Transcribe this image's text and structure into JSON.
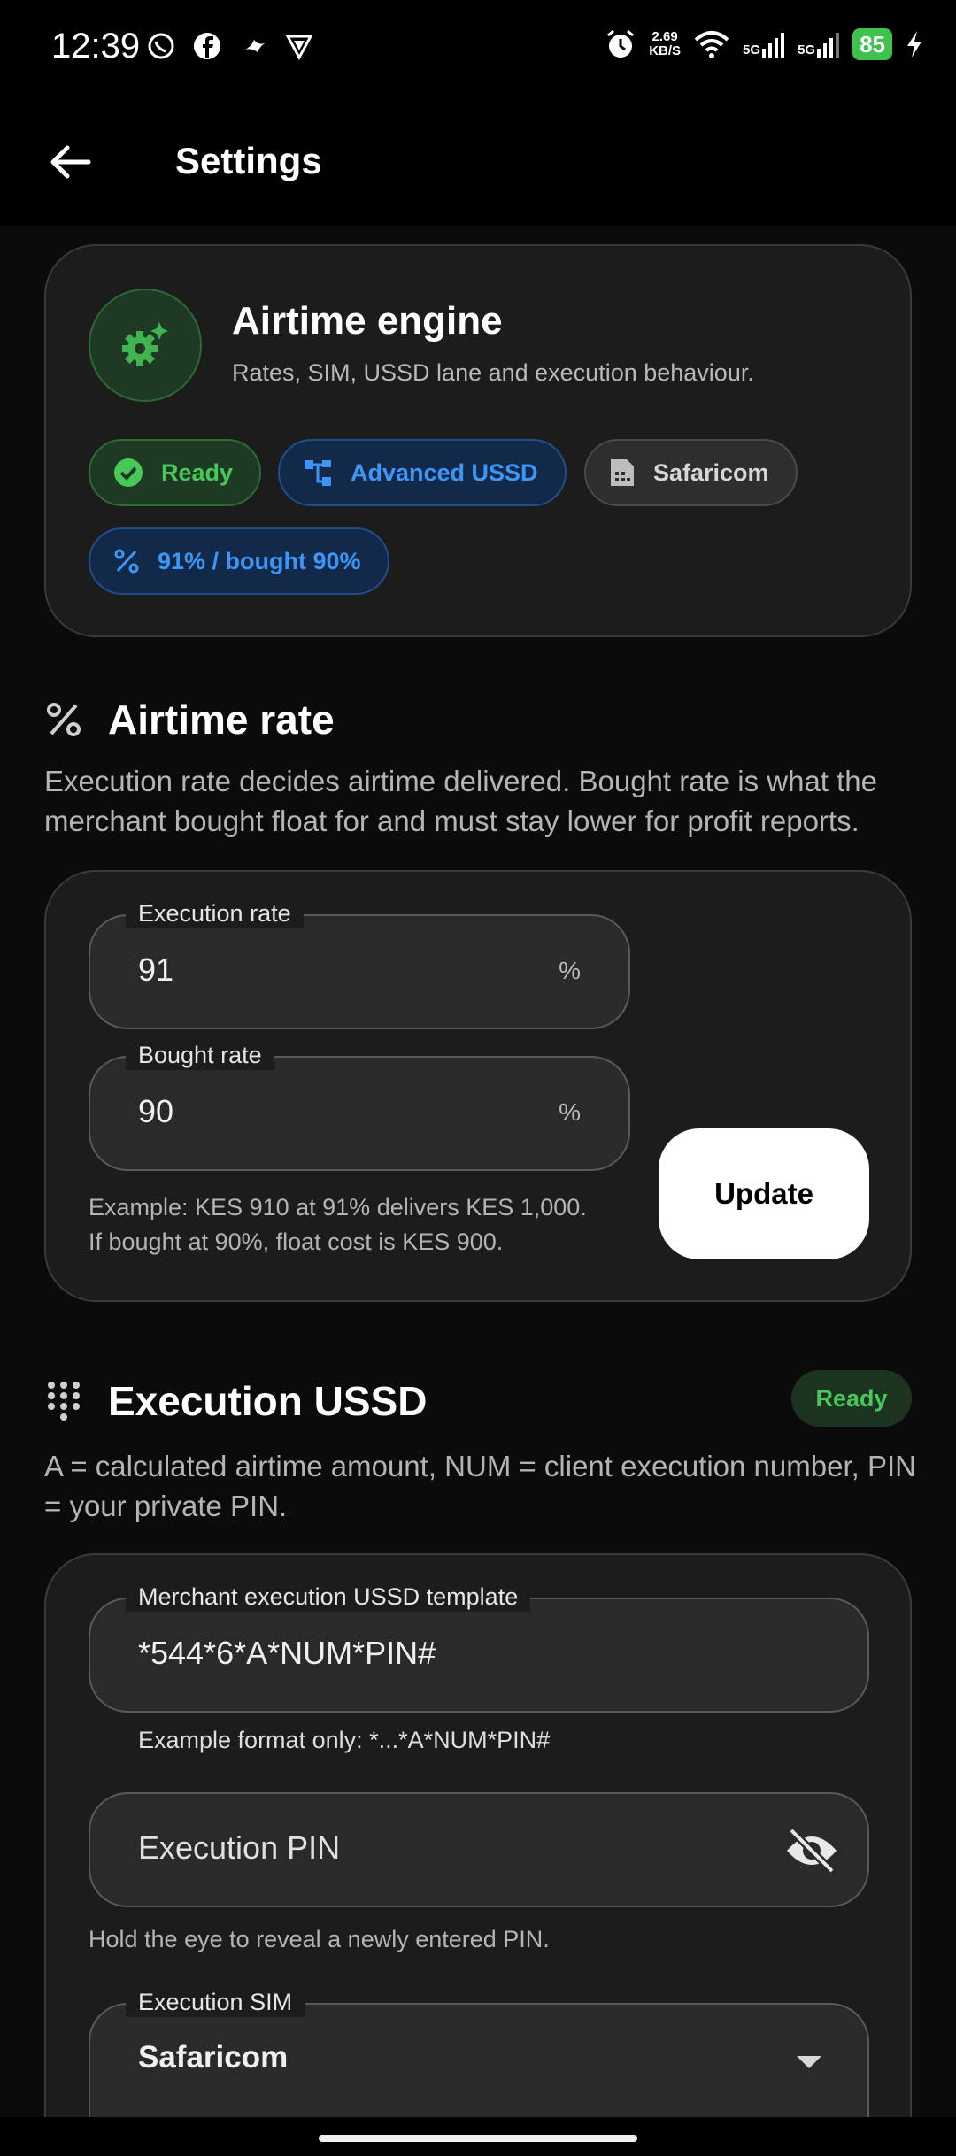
{
  "status_bar": {
    "time": "12:39",
    "net_speed_value": "2.69",
    "net_speed_unit": "KB/S",
    "sim1_label": "5G",
    "sim2_label": "5G",
    "battery": "85",
    "icons": [
      "whatsapp-icon",
      "facebook-icon",
      "bird-icon",
      "vpn-icon",
      "alarm-icon",
      "wifi-icon",
      "signal-icon",
      "charging-icon"
    ]
  },
  "app_bar": {
    "title": "Settings"
  },
  "engine": {
    "title": "Airtime engine",
    "subtitle": "Rates, SIM, USSD lane and execution behaviour.",
    "chips": {
      "ready": "Ready",
      "advanced": "Advanced USSD",
      "sim": "Safaricom",
      "rate": "91% / bought 90%"
    }
  },
  "airtime_rate": {
    "title": "Airtime rate",
    "description": "Execution rate decides airtime delivered. Bought rate is what the merchant bought float for and must stay lower for profit reports.",
    "execution_label": "Execution rate",
    "execution_value": "91",
    "bought_label": "Bought rate",
    "bought_value": "90",
    "suffix": "%",
    "example_line1": "Example: KES 910 at 91% delivers KES 1,000.",
    "example_line2": "If bought at 90%, float cost is KES 900.",
    "update_label": "Update"
  },
  "execution_ussd": {
    "title": "Execution USSD",
    "status": "Ready",
    "description": "A = calculated airtime amount, NUM = client execution number, PIN = your private PIN.",
    "template_label": "Merchant execution USSD template",
    "template_value": "*544*6*A*NUM*PIN#",
    "template_hint": "Example format only: *...*A*NUM*PIN#",
    "pin_placeholder": "Execution PIN",
    "pin_hint": "Hold the eye to reveal a newly entered PIN.",
    "sim_label": "Execution SIM",
    "sim_value": "Safaricom"
  },
  "colors": {
    "background": "#0b0b0b",
    "card": "#1c1c1c",
    "green": "#48c75a",
    "blue": "#3d95f5"
  }
}
